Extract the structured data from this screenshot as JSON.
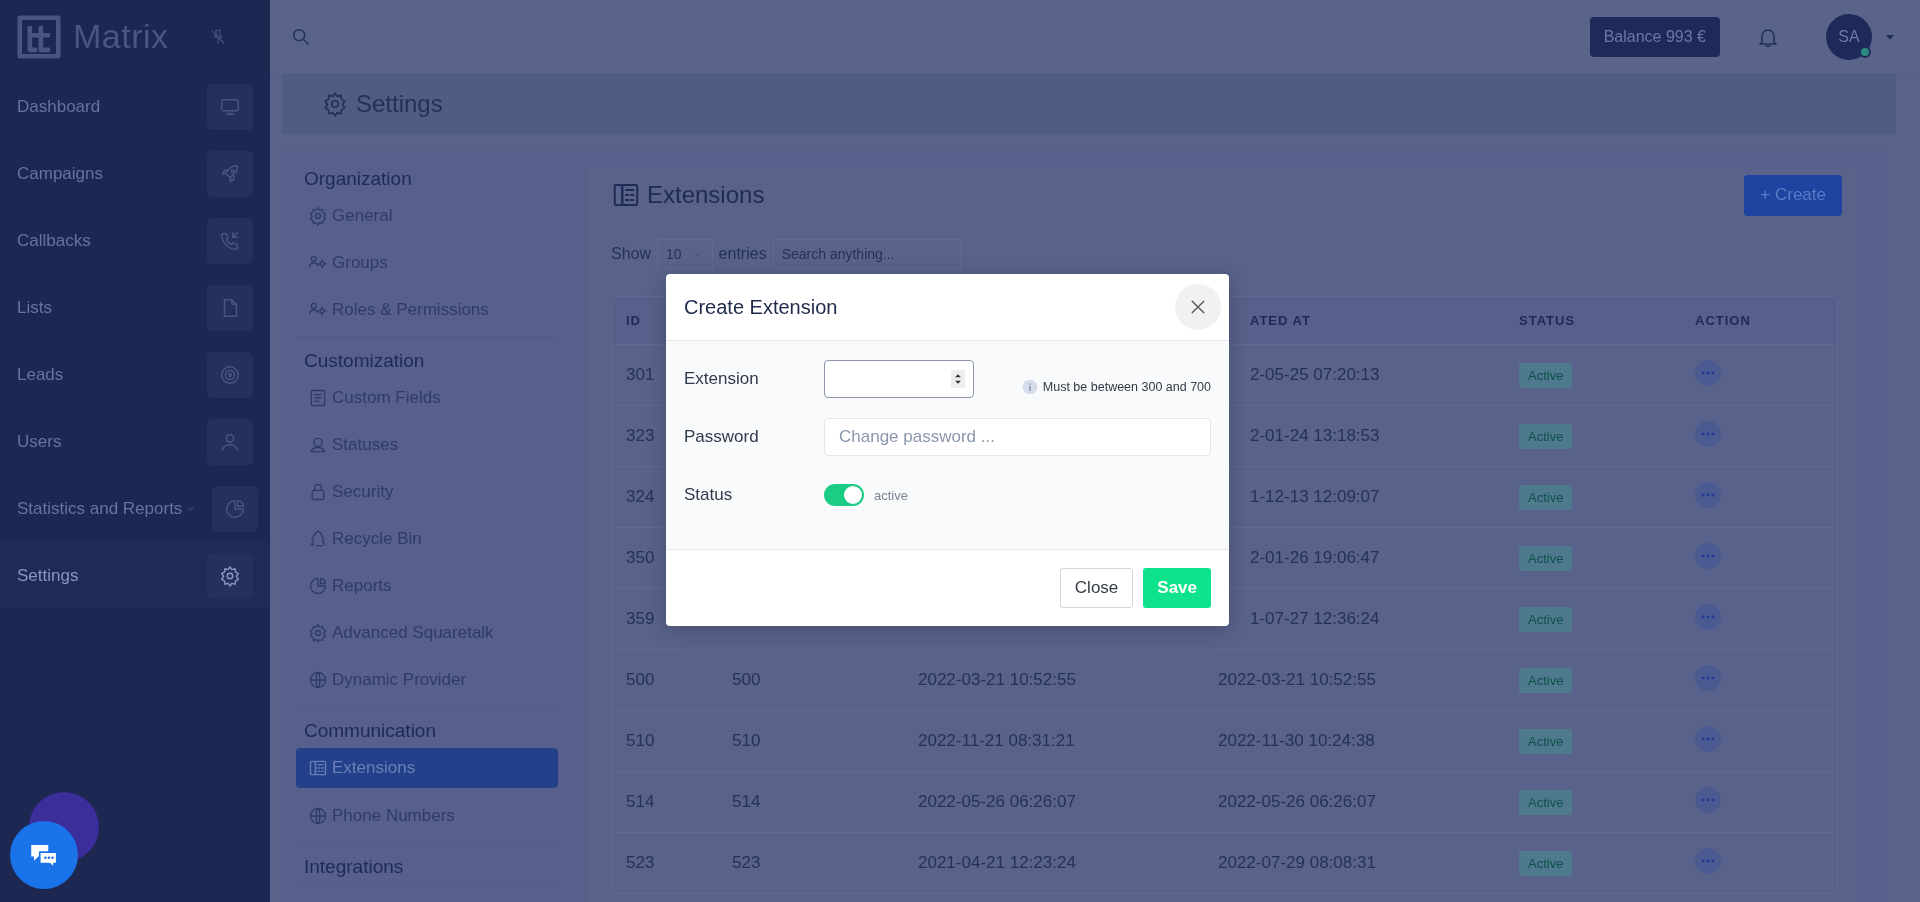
{
  "app": {
    "logo": "Matrix"
  },
  "sidebar": {
    "items": [
      {
        "label": "Dashboard",
        "selected": false,
        "has_submenu": false
      },
      {
        "label": "Campaigns",
        "selected": false,
        "has_submenu": false
      },
      {
        "label": "Callbacks",
        "selected": false,
        "has_submenu": false
      },
      {
        "label": "Lists",
        "selected": false,
        "has_submenu": false
      },
      {
        "label": "Leads",
        "selected": false,
        "has_submenu": false
      },
      {
        "label": "Users",
        "selected": false,
        "has_submenu": false
      },
      {
        "label": "Statistics and Reports",
        "selected": false,
        "has_submenu": true
      },
      {
        "label": "Settings",
        "selected": true,
        "has_submenu": false
      }
    ]
  },
  "topbar": {
    "balance": "Balance 993 €",
    "avatar": "SA",
    "online": true
  },
  "page_title": "Settings",
  "settings_menu": {
    "sections": [
      {
        "title": "Organization",
        "items": [
          {
            "label": "General",
            "selected": false
          },
          {
            "label": "Groups",
            "selected": false
          },
          {
            "label": "Roles & Permissions",
            "selected": false
          }
        ]
      },
      {
        "title": "Customization",
        "items": [
          {
            "label": "Custom Fields",
            "selected": false
          },
          {
            "label": "Statuses",
            "selected": false
          },
          {
            "label": "Security",
            "selected": false
          },
          {
            "label": "Recycle Bin",
            "selected": false
          },
          {
            "label": "Reports",
            "selected": false
          },
          {
            "label": "Advanced Squaretalk",
            "selected": false
          },
          {
            "label": "Dynamic Provider",
            "selected": false
          }
        ]
      },
      {
        "title": "Communication",
        "items": [
          {
            "label": "Extensions",
            "selected": true
          },
          {
            "label": "Phone Numbers",
            "selected": false
          }
        ]
      },
      {
        "title": "Integrations"
      }
    ]
  },
  "extensions": {
    "title": "Extensions",
    "create_button": "+ Create",
    "show_label": "Show",
    "page_size": "10",
    "entries_label": "entries",
    "search_placeholder": "Search anything...",
    "columns": [
      "ID",
      "ATED AT",
      "STATUS",
      "ACTION"
    ],
    "rows": [
      {
        "id": "301",
        "updated": "2-05-25 07:20:13",
        "status": "Active"
      },
      {
        "id": "323",
        "updated": "2-01-24 13:18:53",
        "status": "Active"
      },
      {
        "id": "324",
        "updated": "1-12-13 12:09:07",
        "status": "Active"
      },
      {
        "id": "350",
        "updated": "2-01-26 19:06:47",
        "status": "Active"
      },
      {
        "id": "359",
        "updated": "1-07-27 12:36:24",
        "status": "Active"
      },
      {
        "id": "500",
        "column_2": "500",
        "created": "2022-03-21 10:52:55",
        "updated": "2022-03-21 10:52:55",
        "status": "Active"
      },
      {
        "id": "510",
        "column_2": "510",
        "created": "2022-11-21 08:31:21",
        "updated": "2022-11-30 10:24:38",
        "status": "Active"
      },
      {
        "id": "514",
        "column_2": "514",
        "created": "2022-05-26 06:26:07",
        "updated": "2022-05-26 06:26:07",
        "status": "Active"
      },
      {
        "id": "523",
        "column_2": "523",
        "created": "2021-04-21 12:23:24",
        "updated": "2022-07-29 08:08:31",
        "status": "Active"
      }
    ]
  },
  "modal": {
    "title": "Create Extension",
    "fields": [
      {
        "kind": "number",
        "label": "Extension",
        "hint": "Must be between 300 and 700"
      },
      {
        "kind": "password",
        "label": "Password",
        "placeholder": "Change password ..."
      },
      {
        "kind": "toggle",
        "label": "Status",
        "on": true,
        "caption": "active"
      }
    ],
    "buttons": [
      {
        "label": "Close",
        "kind": "secondary"
      },
      {
        "label": "Save",
        "kind": "primary"
      }
    ]
  }
}
